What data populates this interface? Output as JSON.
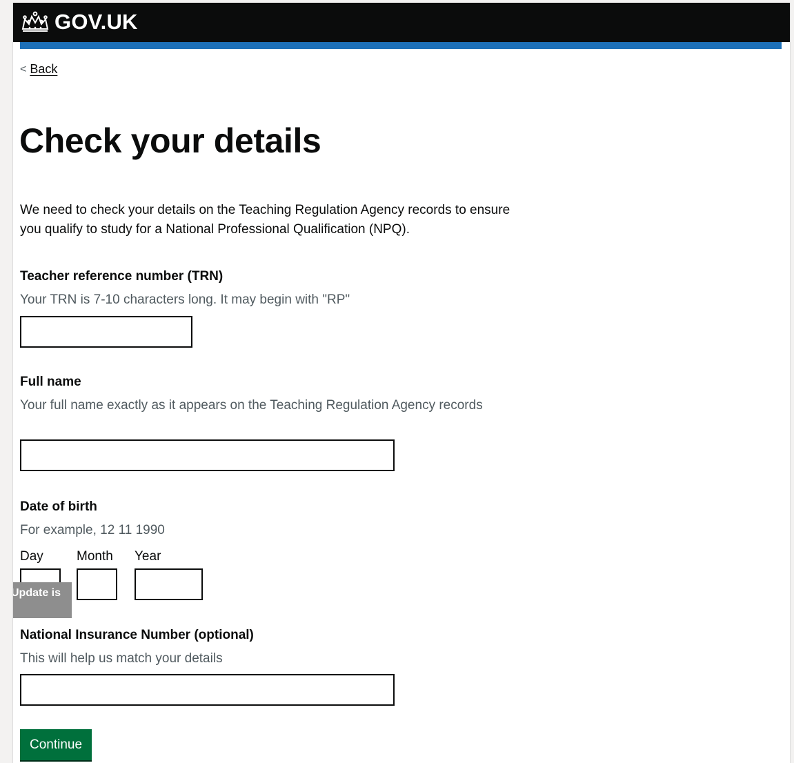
{
  "header": {
    "logo_icon": "crown-icon",
    "logo_text": "GOV.UK"
  },
  "nav": {
    "back_chevron": "<",
    "back_label": "Back"
  },
  "main": {
    "title": "Check your details",
    "intro": "We need to check your details on the Teaching Regulation Agency records to ensure you qualify to study for a National Professional Qualification (NPQ).",
    "trn": {
      "label": "Teacher reference number (TRN)",
      "hint": "Your TRN is 7-10 characters long. It may begin with \"RP\"",
      "value": ""
    },
    "full_name": {
      "label": "Full name",
      "hint": "Your full name exactly as it appears on the Teaching Regulation Agency records",
      "value": ""
    },
    "dob": {
      "label": "Date of birth",
      "hint": "For example, 12 11 1990",
      "day_label": "Day",
      "month_label": "Month",
      "year_label": "Year",
      "day_value": "",
      "month_value": "",
      "year_value": ""
    },
    "ni_number": {
      "label": "National Insurance Number (optional)",
      "hint": "This will help us match your details",
      "value": ""
    },
    "continue_label": "Continue"
  },
  "overlay": {
    "tooltip_text": "Update is"
  },
  "colors": {
    "header_bg": "#0b0c0c",
    "accent_bar": "#1d70b8",
    "button_green": "#00703c",
    "hint_text": "#505a5f"
  }
}
